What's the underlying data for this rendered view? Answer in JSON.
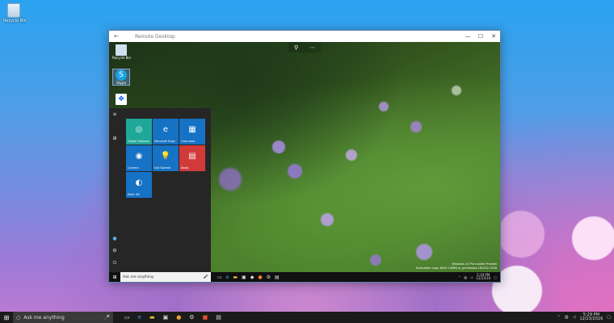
{
  "desktop": {
    "recycle_bin_label": "Recycle Bin"
  },
  "remote_window": {
    "title": "Remote Desktop",
    "back": "←",
    "minimize": "—",
    "maximize": "☐",
    "close": "✕",
    "zoom_icon": "⚲",
    "more_icon": "⋯"
  },
  "inner_desktop": {
    "icons": [
      {
        "label": "Recycle Bin",
        "glyph": "🗑"
      },
      {
        "label": "Skype",
        "glyph": "S"
      },
      {
        "label": "",
        "glyph": "❖"
      }
    ]
  },
  "start_menu": {
    "rail": {
      "hamburger": "≡",
      "apps": "⊞",
      "user": "●",
      "settings": "⚙",
      "power": "⏻"
    },
    "tiles": [
      {
        "label": "Digital Seasons",
        "glyph": "◎",
        "color": "#1fa89a"
      },
      {
        "label": "Microsoft Edge",
        "glyph": "e",
        "color": "#1572c4"
      },
      {
        "label": "Calculator",
        "glyph": "▦",
        "color": "#1572c4"
      },
      {
        "label": "Camera",
        "glyph": "◉",
        "color": "#1572c4"
      },
      {
        "label": "Get Started",
        "glyph": "💡",
        "color": "#1572c4"
      },
      {
        "label": "News",
        "glyph": "▤",
        "color": "#d23a3a"
      },
      {
        "label": "Paint 3D",
        "glyph": "◐",
        "color": "#1572c4"
      }
    ]
  },
  "inner_taskbar": {
    "start": "⊞",
    "search_text": "Ask me anything",
    "mic": "🎤",
    "watermark_line1": "Windows 10 Pro Insider Preview",
    "watermark_line2": "Evaluation copy. Build 14986.rs_prerelease.161202-1928",
    "time": "5:29 PM",
    "date": "12/23/16"
  },
  "taskbar": {
    "start": "⊞",
    "search_text": "Ask me anything",
    "mic": "🎤",
    "time": "5:29 PM",
    "date": "12/23/2016"
  }
}
